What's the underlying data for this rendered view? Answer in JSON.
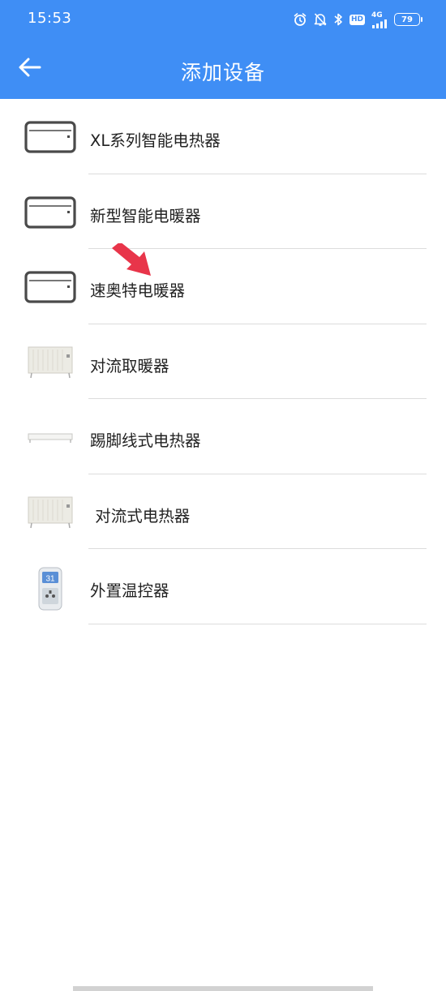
{
  "status_bar": {
    "time": "15:53",
    "hd": "HD",
    "network": "4G",
    "battery": "79",
    "icons": [
      "alarm-icon",
      "mute-bell-icon",
      "bluetooth-icon",
      "hd-icon",
      "signal-icon",
      "battery-icon"
    ]
  },
  "header": {
    "title": "添加设备",
    "back_icon": "arrow-left-icon",
    "background": "#3f8ef5"
  },
  "devices": [
    {
      "label": "XL系列智能电热器",
      "icon": "panel-heater-outline-icon"
    },
    {
      "label": "新型智能电暖器",
      "icon": "panel-heater-outline-icon"
    },
    {
      "label": "速奥特电暖器",
      "icon": "panel-heater-outline-icon"
    },
    {
      "label": "对流取暖器",
      "icon": "convection-heater-icon"
    },
    {
      "label": "踢脚线式电热器",
      "icon": "baseboard-heater-icon"
    },
    {
      "label": " 对流式电热器",
      "icon": "convection-heater-icon"
    },
    {
      "label": "外置温控器",
      "icon": "plug-thermostat-icon"
    }
  ],
  "annotation": {
    "icon": "red-arrow-icon",
    "color": "#e8354a"
  }
}
